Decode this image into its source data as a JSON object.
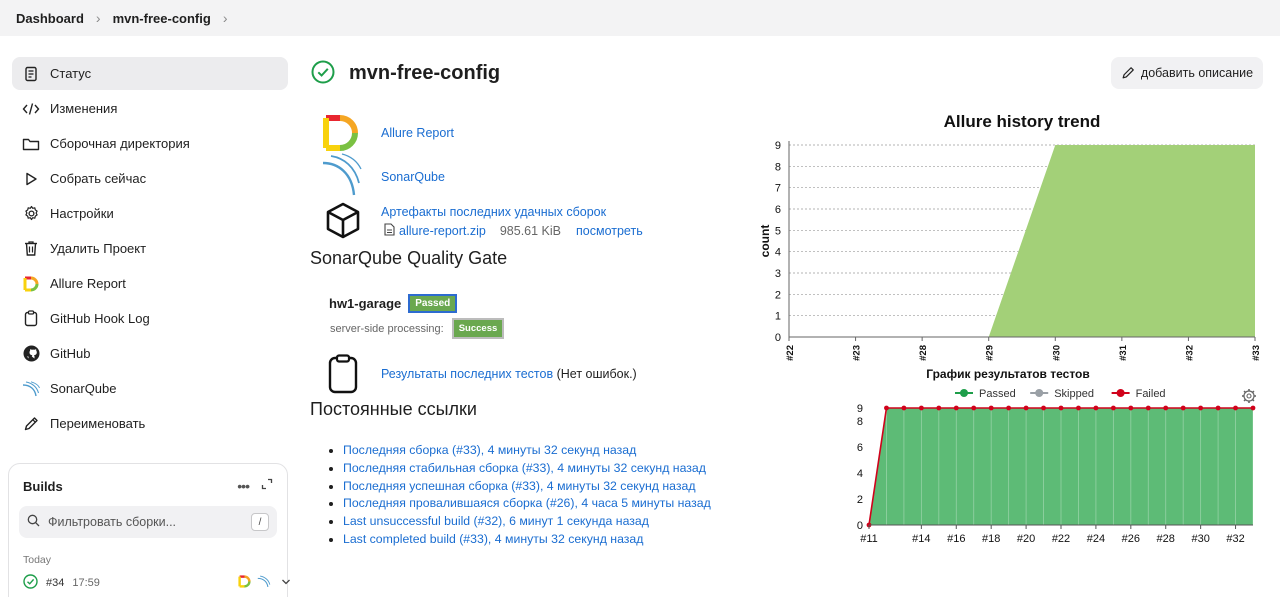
{
  "breadcrumb": {
    "home": "Dashboard",
    "project": "mvn-free-config"
  },
  "sidebar": {
    "items": [
      {
        "label": "Статус",
        "icon": "document-icon"
      },
      {
        "label": "Изменения",
        "icon": "code-icon"
      },
      {
        "label": "Сборочная директория",
        "icon": "folder-icon"
      },
      {
        "label": "Собрать сейчас",
        "icon": "play-icon"
      },
      {
        "label": "Настройки",
        "icon": "gear-icon"
      },
      {
        "label": "Удалить Проект",
        "icon": "trash-icon"
      },
      {
        "label": "Allure Report",
        "icon": "allure-icon"
      },
      {
        "label": "GitHub Hook Log",
        "icon": "clipboard-icon"
      },
      {
        "label": "GitHub",
        "icon": "github-icon"
      },
      {
        "label": "SonarQube",
        "icon": "sonarqube-icon"
      },
      {
        "label": "Переименовать",
        "icon": "pencil-icon"
      }
    ]
  },
  "builds": {
    "title": "Builds",
    "filter_placeholder": "Фильтровать сборки...",
    "filter_shortcut": "/",
    "group_label": "Today",
    "rows": [
      {
        "number": "#34",
        "time": "17:59"
      }
    ]
  },
  "main": {
    "title": "mvn-free-config",
    "add_description": "добавить описание",
    "allure_link": "Allure Report",
    "sonar_link": "SonarQube",
    "artifacts_link": "Артефакты последних удачных сборок",
    "artifact_file": "allure-report.zip",
    "artifact_size": "985.61 KiB",
    "artifact_view": "посмотреть",
    "quality_gate_title": "SonarQube Quality Gate",
    "project_name": "hw1-garage",
    "gate_status": "Passed",
    "processing_label": "server-side processing:",
    "processing_status": "Success",
    "test_results_link": "Результаты последних тестов",
    "test_results_note": " (Нет ошибок.)",
    "permalinks_title": "Постоянные ссылки",
    "permalinks": [
      "Последняя сборка (#33), 4 минуты 32 секунд назад",
      "Последняя стабильная сборка (#33), 4 минуты 32 секунд назад",
      "Последняя успешная сборка (#33), 4 минуты 32 секунд назад",
      "Последняя провалившаяся сборка (#26), 4 часа 5 минуты назад",
      "Last unsuccessful build (#32), 6 минут 1 секунда назад",
      "Last completed build (#33), 4 минуты 32 секунд назад"
    ]
  },
  "colors": {
    "accent": "#1a6dd1",
    "success_green": "#1e9e4a",
    "allure_green": "#a3d078",
    "test_green": "#5dbb76",
    "failed_red": "#d0021b"
  },
  "chart_data": [
    {
      "type": "area",
      "title": "Allure history trend",
      "xlabel": "",
      "ylabel": "count",
      "categories": [
        "#22",
        "#23",
        "#28",
        "#29",
        "#30",
        "#31",
        "#32",
        "#33"
      ],
      "values": [
        0,
        0,
        0,
        0,
        9,
        9,
        9,
        9
      ],
      "ylim": [
        0,
        9
      ],
      "yticks": [
        0,
        1,
        2,
        3,
        4,
        5,
        6,
        7,
        8,
        9
      ],
      "grid": true
    },
    {
      "type": "area",
      "title": "График результатов тестов",
      "legend": [
        "Passed",
        "Skipped",
        "Failed"
      ],
      "legend_colors": [
        "#1e9e4a",
        "#9aa0a6",
        "#d0021b"
      ],
      "x": [
        "#11",
        "#12",
        "#13",
        "#14",
        "#15",
        "#16",
        "#17",
        "#18",
        "#19",
        "#20",
        "#21",
        "#22",
        "#23",
        "#24",
        "#25",
        "#26",
        "#27",
        "#28",
        "#29",
        "#30",
        "#31",
        "#32",
        "#33"
      ],
      "x_tick_labels": [
        "#11",
        "#14",
        "#16",
        "#18",
        "#20",
        "#22",
        "#24",
        "#26",
        "#28",
        "#30",
        "#32"
      ],
      "series": [
        {
          "name": "Passed",
          "values": [
            0,
            9,
            9,
            9,
            9,
            9,
            9,
            9,
            9,
            9,
            9,
            9,
            9,
            9,
            9,
            9,
            9,
            9,
            9,
            9,
            9,
            9,
            9
          ]
        },
        {
          "name": "Skipped",
          "values": [
            0,
            0,
            0,
            0,
            0,
            0,
            0,
            0,
            0,
            0,
            0,
            0,
            0,
            0,
            0,
            0,
            0,
            0,
            0,
            0,
            0,
            0,
            0
          ]
        },
        {
          "name": "Failed",
          "values": [
            0,
            9,
            9,
            9,
            9,
            9,
            9,
            9,
            9,
            9,
            9,
            9,
            9,
            9,
            9,
            9,
            9,
            9,
            9,
            9,
            9,
            9,
            9
          ]
        }
      ],
      "yticks": [
        0,
        2,
        4,
        6,
        8,
        9
      ],
      "ylim": [
        0,
        9
      ],
      "legend_position": "top"
    }
  ]
}
